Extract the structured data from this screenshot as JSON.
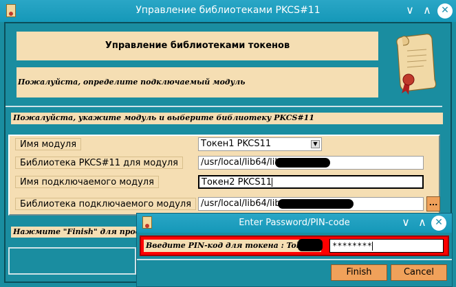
{
  "main_window": {
    "title": "Управление библиотеками PKCS#11",
    "header_title": "Управление библиотеками токенов",
    "header_subtitle": "Пожалуйста, определите подключаемый модуль",
    "section_caption": "Пожалуйста, укажите модуль и выберите библиотеку PKCS#11",
    "fields": [
      {
        "label": "Имя модуля",
        "value": "Токен1 PKCS11"
      },
      {
        "label": "Библиотека PKCS#11 для модуля",
        "value": "/usr/local/lib64/lib"
      },
      {
        "label": "Имя подключаемого модуля",
        "value": "Токен2 PKCS11"
      },
      {
        "label": "Библиотека подключаемого модуля",
        "value": "/usr/local/lib64/lib"
      }
    ],
    "browse_label": "...",
    "bottom_note": "Нажмите \"Finish\" для продол",
    "window_buttons": {
      "minimize": "∨",
      "maximize": "∧",
      "close": "✕"
    }
  },
  "dialog": {
    "title": "Enter Password/PIN-code",
    "prompt": "Введите PIN-код для токена :   Token",
    "pin_value": "********",
    "finish_label": "Finish",
    "cancel_label": "Cancel",
    "window_buttons": {
      "minimize": "∨",
      "maximize": "∧",
      "close": "✕"
    }
  },
  "colors": {
    "background": "#1a8da0",
    "panel": "#f5deb3",
    "titlebar": "#1e9cbc",
    "button": "#f0a15a",
    "dialog_alert": "#ff0000"
  }
}
